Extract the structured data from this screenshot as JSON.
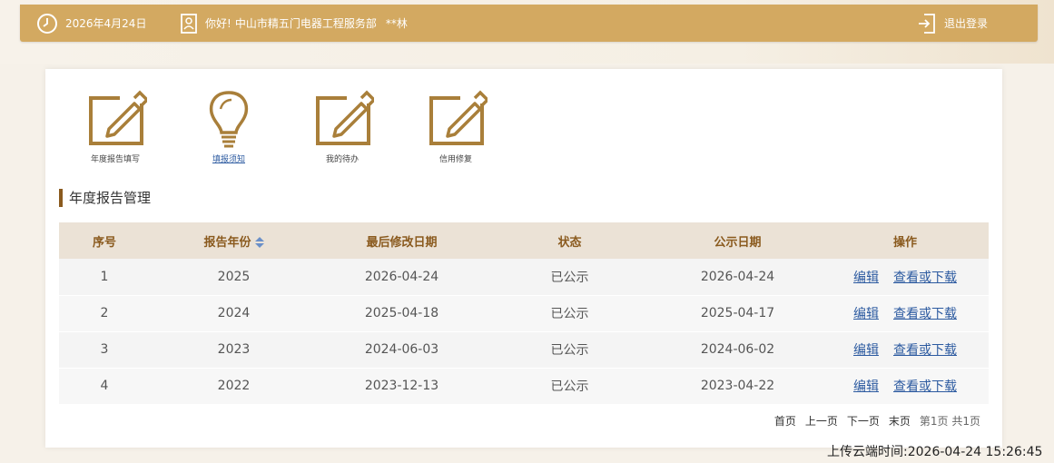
{
  "header": {
    "date": "2026年4月24日",
    "greeting": "你好!",
    "company": "中山市精五门电器工程服务部",
    "user": "**林",
    "logout_label": "退出登录"
  },
  "quick_links": [
    {
      "label": "年度报告填写",
      "icon": "edit-icon"
    },
    {
      "label": "填报须知",
      "icon": "lightbulb-icon"
    },
    {
      "label": "我的待办",
      "icon": "edit-icon"
    },
    {
      "label": "信用修复",
      "icon": "edit-icon"
    }
  ],
  "section_title": "年度报告管理",
  "table": {
    "headers": [
      "序号",
      "报告年份",
      "最后修改日期",
      "状态",
      "公示日期",
      "操作"
    ],
    "rows": [
      {
        "no": "1",
        "year": "2025",
        "modified": "2026-04-24",
        "status": "已公示",
        "published": "2026-04-24",
        "edit": "编辑",
        "view": "查看或下载"
      },
      {
        "no": "2",
        "year": "2024",
        "modified": "2025-04-18",
        "status": "已公示",
        "published": "2025-04-17",
        "edit": "编辑",
        "view": "查看或下载"
      },
      {
        "no": "3",
        "year": "2023",
        "modified": "2024-06-03",
        "status": "已公示",
        "published": "2024-06-02",
        "edit": "编辑",
        "view": "查看或下载"
      },
      {
        "no": "4",
        "year": "2022",
        "modified": "2023-12-13",
        "status": "已公示",
        "published": "2023-04-22",
        "edit": "编辑",
        "view": "查看或下载"
      }
    ]
  },
  "pager": {
    "first": "首页",
    "prev": "上一页",
    "next": "下一页",
    "last": "末页",
    "info": "第1页 共1页"
  },
  "upload_time": "上传云端时间:2026-04-24 15:26:45",
  "colors": {
    "accent": "#d3a961",
    "brown": "#8a5a1e",
    "link": "#2c5aa0"
  }
}
